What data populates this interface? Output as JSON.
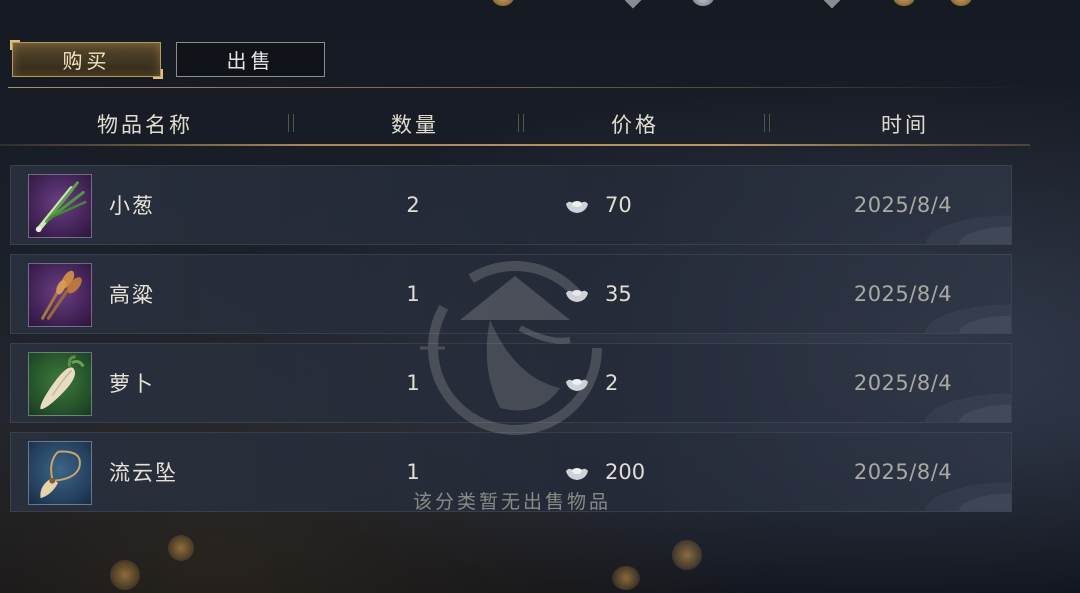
{
  "tabs": {
    "buy_label": "购买",
    "sell_label": "出售"
  },
  "columns": {
    "name": "物品名称",
    "quantity": "数量",
    "price": "价格",
    "time": "时间"
  },
  "rows": [
    {
      "name": "小葱",
      "quantity": "2",
      "price": "70",
      "time": "2025/8/4",
      "icon": "scallion-icon",
      "rarity_color": "#5a3472"
    },
    {
      "name": "高粱",
      "quantity": "1",
      "price": "35",
      "time": "2025/8/4",
      "icon": "sorghum-icon",
      "rarity_color": "#5a3472"
    },
    {
      "name": "萝卜",
      "quantity": "1",
      "price": "2",
      "time": "2025/8/4",
      "icon": "radish-icon",
      "rarity_color": "#2f6a33"
    },
    {
      "name": "流云坠",
      "quantity": "1",
      "price": "200",
      "time": "2025/8/4",
      "icon": "pendant-icon",
      "rarity_color": "#2e5478"
    }
  ],
  "empty_message": "该分类暂无出售物品",
  "colors": {
    "accent_gold": "#b89a5e",
    "background": "#1a1f2a"
  }
}
